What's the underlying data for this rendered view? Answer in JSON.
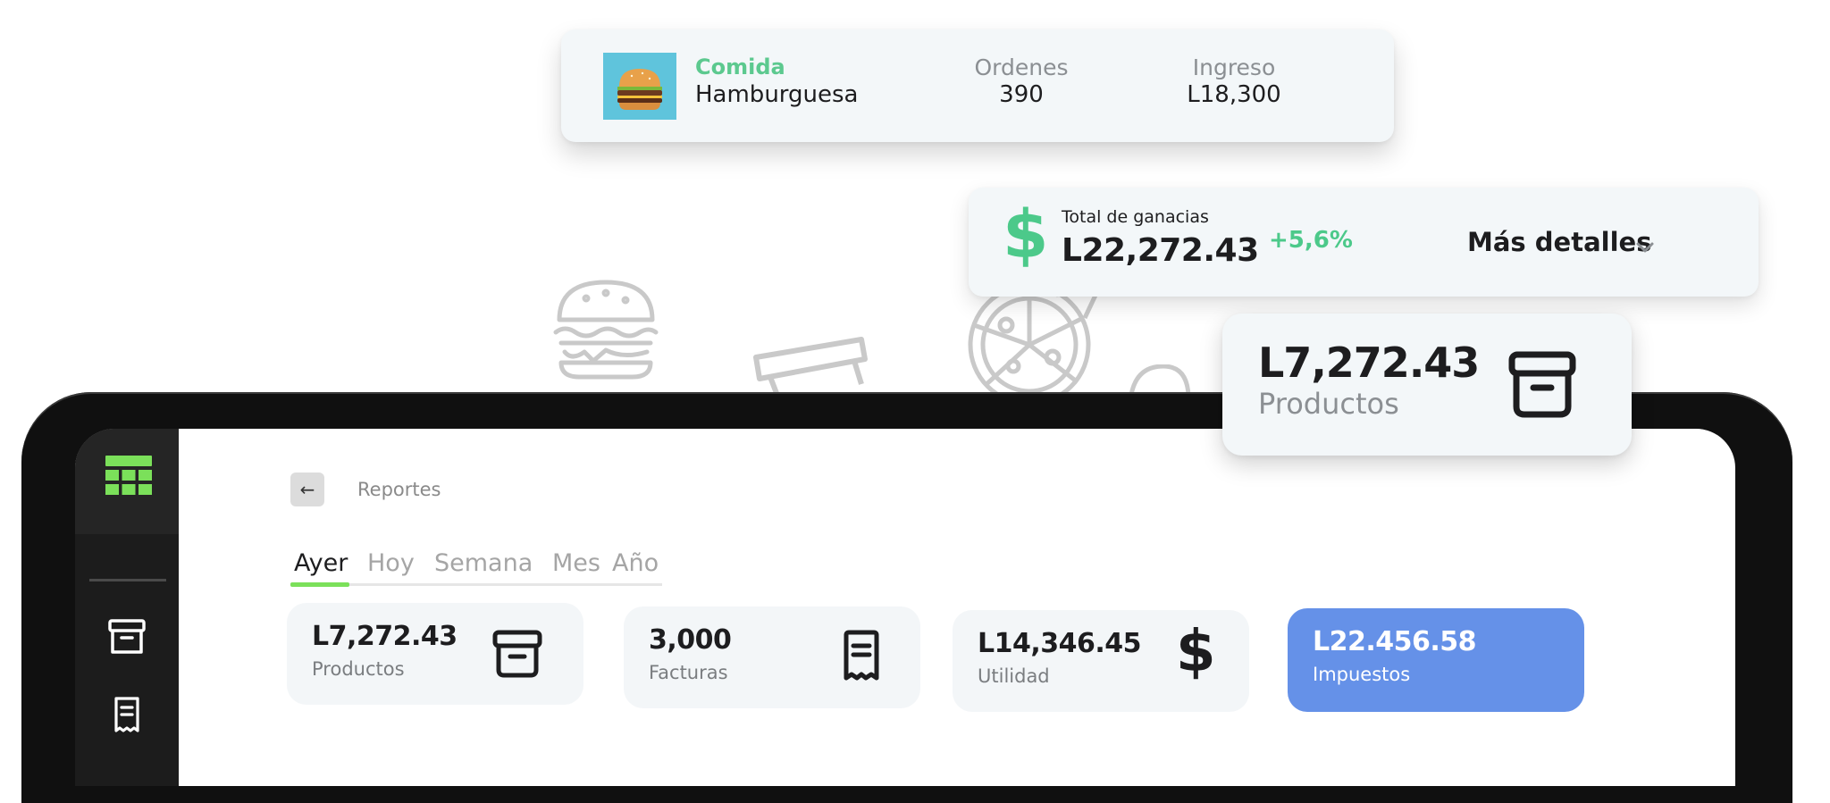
{
  "food_card": {
    "category": "Comida",
    "name": "Hamburguesa",
    "orders_label": "Ordenes",
    "orders_value": "390",
    "income_label": "Ingreso",
    "income_value": "L18,300"
  },
  "total_card": {
    "label": "Total de ganacias",
    "value": "L22,272.43",
    "change": "+5,6%",
    "more_label": "Más detalles",
    "icon": "dollar-icon",
    "accent_color": "#4cc98a"
  },
  "products_card": {
    "value": "L7,272.43",
    "label": "Productos",
    "icon": "archive-box-icon"
  },
  "sidebar": {
    "items": [
      {
        "icon": "grid-icon",
        "active": true
      },
      {
        "icon": "archive-box-icon"
      },
      {
        "icon": "receipt-icon"
      }
    ],
    "active_color": "#7be05a"
  },
  "header": {
    "back_label": "←",
    "breadcrumb": "Reportes"
  },
  "tabs": [
    {
      "label": "Ayer",
      "active": true
    },
    {
      "label": "Hoy"
    },
    {
      "label": "Semana"
    },
    {
      "label": "Mes"
    },
    {
      "label": "Año"
    }
  ],
  "stats": [
    {
      "value": "L7,272.43",
      "label": "Productos",
      "icon": "archive-box-icon"
    },
    {
      "value": "3,000",
      "label": "Facturas",
      "icon": "receipt-icon"
    },
    {
      "value": "L14,346.45",
      "label": "Utilidad",
      "icon": "dollar-icon"
    },
    {
      "value": "L22.456.58",
      "label": "Impuestos",
      "highlight_color": "#6591e8"
    }
  ]
}
